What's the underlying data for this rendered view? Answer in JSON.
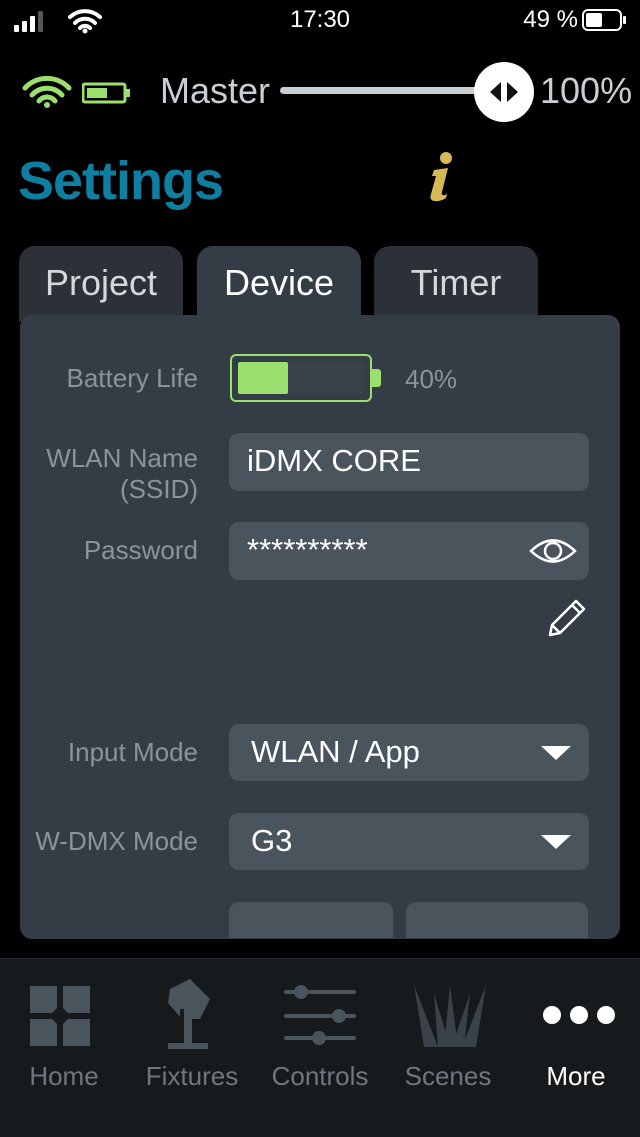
{
  "status_bar": {
    "time": "17:30",
    "battery_percent": "49 %"
  },
  "header": {
    "master_label": "Master",
    "master_value": "100%",
    "master_level": 1.0,
    "title": "Settings"
  },
  "tabs": [
    {
      "label": "Project",
      "active": false
    },
    {
      "label": "Device",
      "active": true
    },
    {
      "label": "Timer",
      "active": false
    }
  ],
  "device": {
    "battery": {
      "label": "Battery Life",
      "percent_text": "40%",
      "level": 0.4
    },
    "wlan_name": {
      "label": "WLAN Name (SSID)",
      "value": "iDMX CORE"
    },
    "password": {
      "label": "Password",
      "value": "**********"
    },
    "input_mode": {
      "label": "Input Mode",
      "value": "WLAN / App"
    },
    "wdmx_mode": {
      "label": "W-DMX Mode",
      "value": "G3"
    }
  },
  "bottom_nav": [
    {
      "label": "Home",
      "icon": "home-icon",
      "active": false
    },
    {
      "label": "Fixtures",
      "icon": "fixture-icon",
      "active": false
    },
    {
      "label": "Controls",
      "icon": "sliders-icon",
      "active": false
    },
    {
      "label": "Scenes",
      "icon": "scenes-icon",
      "active": false
    },
    {
      "label": "More",
      "icon": "more-icon",
      "active": true
    }
  ],
  "colors": {
    "accent": "#0e7fa1",
    "battery_green": "#9be06e",
    "panel": "#343d45",
    "field": "#4a545d",
    "info_gold": "#d7b858"
  }
}
